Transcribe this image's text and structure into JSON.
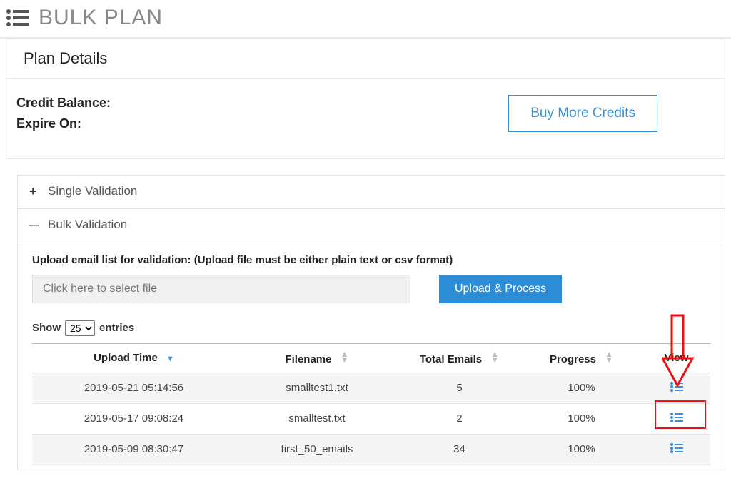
{
  "header": {
    "title": "BULK PLAN"
  },
  "plan": {
    "title": "Plan Details",
    "credit_label": "Credit Balance:",
    "expire_label": "Expire On:",
    "buy_button": "Buy More Credits"
  },
  "accordion": {
    "single": {
      "sign": "+",
      "label": "Single Validation"
    },
    "bulk": {
      "sign": "—",
      "label": "Bulk Validation"
    }
  },
  "bulk": {
    "upload_label": "Upload email list for validation: (Upload file must be either plain text or csv format)",
    "file_placeholder": "Click here to select file",
    "upload_button": "Upload & Process",
    "show_prefix": "Show",
    "show_value": "25",
    "show_suffix": "entries"
  },
  "table": {
    "columns": {
      "upload_time": "Upload Time",
      "filename": "Filename",
      "total_emails": "Total Emails",
      "progress": "Progress",
      "view": "View"
    },
    "rows": [
      {
        "upload_time": "2019-05-21 05:14:56",
        "filename": "smalltest1.txt",
        "total_emails": "5",
        "progress": "100%"
      },
      {
        "upload_time": "2019-05-17 09:08:24",
        "filename": "smalltest.txt",
        "total_emails": "2",
        "progress": "100%"
      },
      {
        "upload_time": "2019-05-09 08:30:47",
        "filename": "first_50_emails",
        "total_emails": "34",
        "progress": "100%"
      }
    ]
  }
}
